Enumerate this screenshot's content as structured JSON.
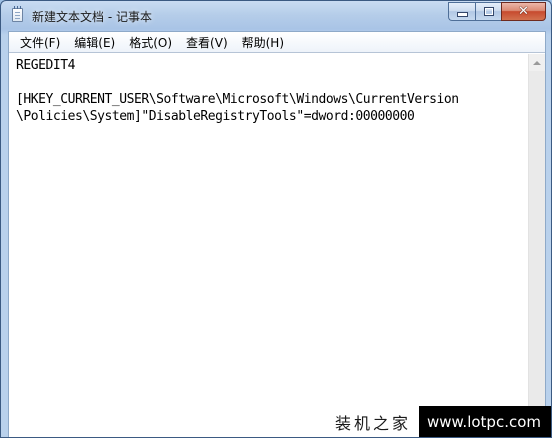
{
  "window": {
    "title": "新建文本文档 - 记事本",
    "app_icon": "notepad-icon"
  },
  "controls": {
    "minimize_icon": "minimize-icon",
    "maximize_icon": "maximize-icon",
    "close_glyph": "✕"
  },
  "menu": {
    "items": [
      {
        "label": "文件(F)"
      },
      {
        "label": "编辑(E)"
      },
      {
        "label": "格式(O)"
      },
      {
        "label": "查看(V)"
      },
      {
        "label": "帮助(H)"
      }
    ]
  },
  "editor": {
    "content": "REGEDIT4\n\n[HKEY_CURRENT_USER\\Software\\Microsoft\\Windows\\CurrentVersion\n\\Policies\\System]\"DisableRegistryTools\"=dword:00000000"
  },
  "watermark": {
    "cn_text": "装机之家",
    "url_text": "www.lotpc.com"
  },
  "colors": {
    "titlebar": "#b5cde9",
    "close_button": "#c74a2e",
    "client_bg": "#ffffff"
  }
}
